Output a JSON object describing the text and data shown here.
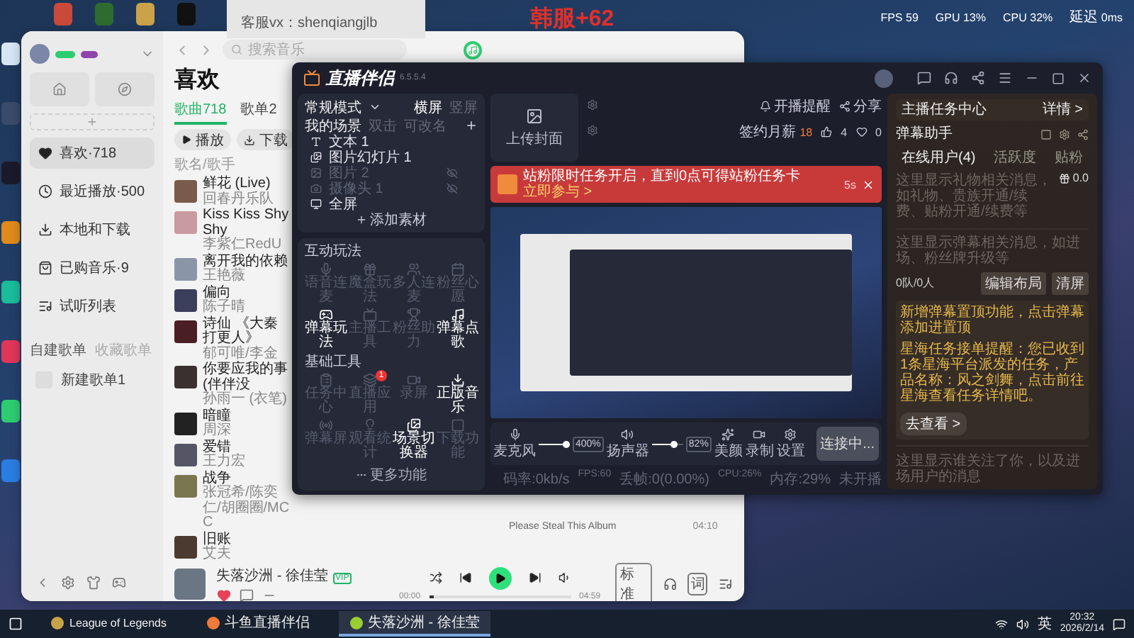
{
  "overlay": {
    "support": "客服vx：shenqiangjlb",
    "server": "韩服+62",
    "stats": [
      {
        "label": "FPS",
        "value": "59"
      },
      {
        "label": "GPU",
        "value": "13%"
      },
      {
        "label": "CPU",
        "value": "32%"
      },
      {
        "label": "延迟",
        "value": "0ms"
      }
    ]
  },
  "music": {
    "search_placeholder": "搜索音乐",
    "nav": [
      {
        "label": "喜欢·718",
        "kind": "heart",
        "selected": true
      },
      {
        "label": "最近播放·500",
        "kind": "clock",
        "selected": false
      },
      {
        "label": "本地和下载",
        "kind": "download",
        "selected": false
      },
      {
        "label": "已购音乐·9",
        "kind": "bag",
        "selected": false
      },
      {
        "label": "试听列表",
        "kind": "list",
        "selected": false
      }
    ],
    "playlist_tabs": [
      {
        "label": "自建歌单",
        "selected": true
      },
      {
        "label": "收藏歌单",
        "selected": false
      }
    ],
    "playlists": [
      "新建歌单1"
    ],
    "title": "喜欢",
    "tabs": [
      {
        "label": "歌曲718",
        "selected": true
      },
      {
        "label": "歌单2",
        "selected": false
      }
    ],
    "actions": [
      {
        "label": "播放",
        "kind": "play"
      },
      {
        "label": "下载",
        "kind": "download"
      }
    ],
    "list_header": "歌名/歌手",
    "songs": [
      {
        "title": "鲜花 (Live)",
        "artist": "回春丹乐队"
      },
      {
        "title": "Kiss Kiss Shy Shy",
        "artist": "李紫仁RedU"
      },
      {
        "title": "离开我的依赖",
        "artist": "王艳薇"
      },
      {
        "title": "偏向",
        "artist": "陈子晴"
      },
      {
        "title": "诗仙 《大秦打更人》",
        "artist": "郁可唯/李金"
      },
      {
        "title": "你要应我的事 (伴伴没",
        "artist": "孙雨一 (衣笔)"
      },
      {
        "title": "暗瞳",
        "artist": "周深"
      },
      {
        "title": "爱错",
        "artist": "王力宏"
      },
      {
        "title": "战争",
        "artist": "张冠希/陈奕仁/胡圈圈/MCC",
        "album": "Please Steal This Album",
        "duration": "04:10"
      },
      {
        "title": "旧账",
        "artist": "艾夫"
      }
    ],
    "player": {
      "title": "失落沙洲 - 徐佳莹",
      "tag": "VIP",
      "liked": true,
      "elapsed": "00:00",
      "total": "04:59",
      "level": 0.03,
      "quality": "标准",
      "lyrics": "词"
    }
  },
  "stream": {
    "title": "直播伴侣",
    "version": "6.5.5.4",
    "mode": "常规模式",
    "orientation": [
      {
        "label": "横屏",
        "selected": true
      },
      {
        "label": "竖屏",
        "selected": false
      }
    ],
    "scene_tabs": [
      {
        "label": "我的场景",
        "selected": true
      },
      {
        "label": "双击",
        "selected": false
      },
      {
        "label": "可改名",
        "selected": false
      }
    ],
    "sources": [
      {
        "label": "文本 1",
        "kind": "text",
        "visible": true
      },
      {
        "label": "图片幻灯片 1",
        "kind": "slideshow",
        "visible": true
      },
      {
        "label": "图片 2",
        "kind": "image",
        "visible": false
      },
      {
        "label": "摄像头 1",
        "kind": "camera",
        "visible": false
      },
      {
        "label": "全屏",
        "kind": "screen",
        "visible": true
      }
    ],
    "add_source": "添加素材",
    "sections": [
      {
        "title": "互动玩法",
        "tools": [
          {
            "label": "语音连麦",
            "enabled": false
          },
          {
            "label": "魔盒玩法",
            "enabled": false
          },
          {
            "label": "多人连麦",
            "enabled": false
          },
          {
            "label": "粉丝心愿",
            "enabled": false
          },
          {
            "label": "弹幕玩法",
            "enabled": true
          },
          {
            "label": "主播工具",
            "enabled": false
          },
          {
            "label": "粉丝助力",
            "enabled": false
          },
          {
            "label": "弹幕点歌",
            "enabled": true
          }
        ]
      },
      {
        "title": "基础工具",
        "tools": [
          {
            "label": "任务中心",
            "enabled": false
          },
          {
            "label": "直播应用",
            "enabled": false,
            "badge": "1"
          },
          {
            "label": "录屏",
            "enabled": false
          },
          {
            "label": "正版音乐",
            "enabled": true
          },
          {
            "label": "弹幕屏",
            "enabled": false
          },
          {
            "label": "观看统计",
            "enabled": false
          },
          {
            "label": "场景切换器",
            "enabled": true
          },
          {
            "label": "下载功能",
            "enabled": false
          }
        ]
      }
    ],
    "more": "更多功能",
    "cover": "上传封面",
    "top_actions": [
      {
        "label": "开播提醒",
        "kind": "bell"
      },
      {
        "label": "分享",
        "kind": "share"
      }
    ],
    "salary": {
      "label": "签约月薪",
      "value": "18"
    },
    "likes": "4",
    "hearts": "0",
    "banner": {
      "text": "站粉限时任务开启，直到0点可得站粉任务卡",
      "link": "立即参与 >",
      "countdown": "5s"
    },
    "mic": {
      "label": "麦克风",
      "level": 1.0,
      "reading": "400%"
    },
    "speaker": {
      "label": "扬声器",
      "level": 0.82,
      "reading": "82%"
    },
    "controls": [
      {
        "label": "美颜",
        "kind": "beauty"
      },
      {
        "label": "录制",
        "kind": "record"
      },
      {
        "label": "设置",
        "kind": "settings"
      }
    ],
    "connect": "连接中...",
    "status": [
      "码率:0kb/s",
      "FPS:60",
      "丢帧:0(0.00%)",
      "CPU:26%",
      "内存:29%",
      "未开播"
    ],
    "panel": {
      "task_center": "主播任务中心",
      "details": "详情 >",
      "assistant": "弹幕助手",
      "tabs": [
        {
          "label": "在线用户(4)",
          "selected": true
        },
        {
          "label": "活跃度",
          "selected": false
        },
        {
          "label": "贴粉",
          "selected": false
        }
      ],
      "gift_hint": "这里显示礼物相关消息，如礼物、贵族开通/续费、贴粉开通/续费等",
      "gift_total": "0.0",
      "danmaku_hint": "这里显示弹幕相关消息，如进场、粉丝牌升级等",
      "queue": "0队/0人",
      "edit_layout": "编辑布局",
      "clear": "清屏",
      "notices": [
        {
          "text": "新增弹幕置顶功能，点击弹幕添加进置顶"
        },
        {
          "text": "星海任务接单提醒：您已收到1条星海平台派发的任务，产品名称：风之剑舞，点击前往星海查看任务详情吧。",
          "link": "去查看 >"
        }
      ],
      "follow_hint": "这里显示谁关注了你，以及进场用户的消息"
    }
  },
  "taskbar": {
    "apps": [
      {
        "label": "League of Legends",
        "kind": "game",
        "selected": false
      },
      {
        "label": "斗鱼直播伴侣",
        "kind": "stream",
        "selected": false
      },
      {
        "label": "失落沙洲 - 徐佳莹",
        "kind": "music",
        "selected": true
      }
    ],
    "ime": "英",
    "time": "20:32",
    "date": "2026/2/14"
  }
}
